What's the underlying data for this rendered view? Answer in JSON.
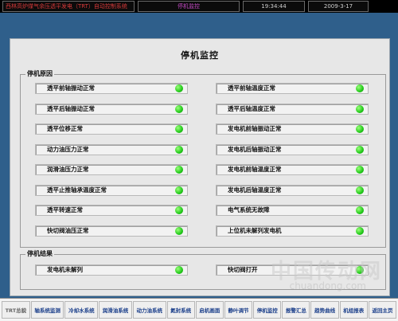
{
  "topbar": {
    "system": "西林高炉煤气余压透平发电（TRT）自动控制系统",
    "title": "停机监控",
    "time": "19:34:44",
    "date": "2009-3-17"
  },
  "panel": {
    "title": "停机监控",
    "stop_group_label": "停机原因",
    "result_group_label": "停机结果"
  },
  "stop_reasons_left": [
    {
      "label": "透平前轴振动正常",
      "status": "ok"
    },
    {
      "label": "透平后轴振动正常",
      "status": "ok"
    },
    {
      "label": "透平位移正常",
      "status": "ok"
    },
    {
      "label": "动力油压力正常",
      "status": "ok"
    },
    {
      "label": "润滑油压力正常",
      "status": "ok"
    },
    {
      "label": "透平止推轴承温度正常",
      "status": "ok"
    },
    {
      "label": "透平转速正常",
      "status": "ok"
    },
    {
      "label": "快切阀油压正常",
      "status": "ok"
    }
  ],
  "stop_reasons_right": [
    {
      "label": "透平前轴温度正常",
      "status": "ok"
    },
    {
      "label": "透平后轴温度正常",
      "status": "ok"
    },
    {
      "label": "发电机前轴振动正常",
      "status": "ok"
    },
    {
      "label": "发电机后轴振动正常",
      "status": "ok"
    },
    {
      "label": "发电机前轴温度正常",
      "status": "ok"
    },
    {
      "label": "发电机后轴温度正常",
      "status": "ok"
    },
    {
      "label": "电气系统无故障",
      "status": "ok"
    },
    {
      "label": "上位机未解列发电机",
      "status": "ok"
    }
  ],
  "stop_results": [
    {
      "label": "发电机未解列",
      "status": "ok"
    },
    {
      "label": "快切阀打开",
      "status": "ok"
    }
  ],
  "nav": [
    "TRT总貌",
    "轴系统监测",
    "冷却水系统",
    "润滑油系统",
    "动力油系统",
    "氮封系统",
    "启机画面",
    "静叶调节",
    "停机监控",
    "报警汇总",
    "趋势曲线",
    "机组报表",
    "返回主页"
  ],
  "colors": {
    "workspace": "#2f5f8b",
    "lamp_ok": "#22c91a"
  },
  "watermark": {
    "main": "中国传动网",
    "sub": "chuandong.com"
  }
}
